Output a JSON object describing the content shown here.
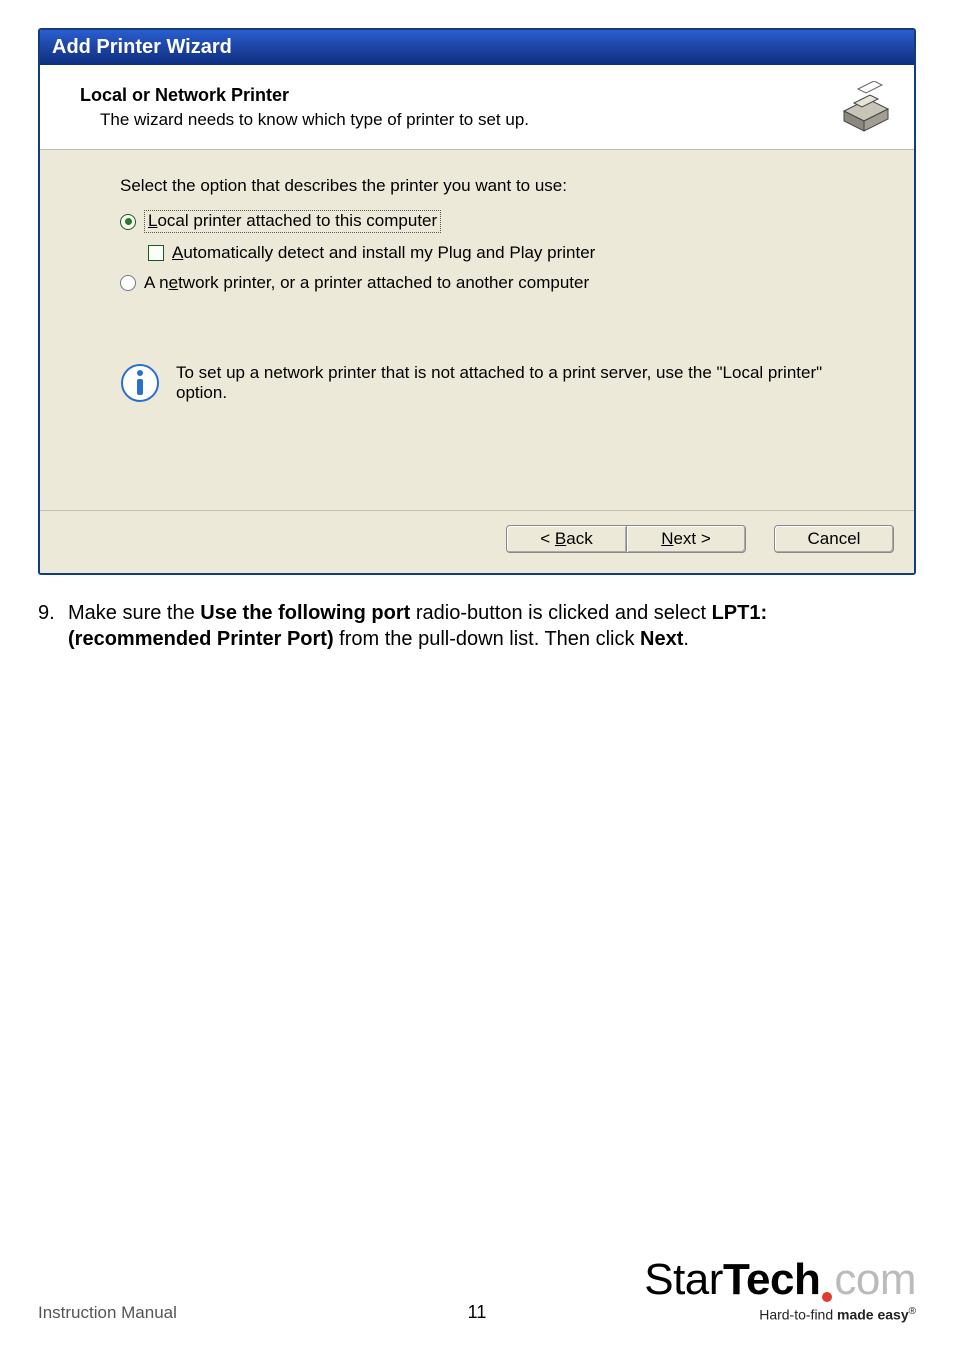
{
  "wizard": {
    "titlebar": "Add Printer Wizard",
    "heading": "Local or Network Printer",
    "subheading": "The wizard needs to know which type of printer to set up.",
    "select_prompt": "Select the option that describes the printer you want to use:",
    "option_local_pre": "L",
    "option_local_post": "ocal printer attached to this computer",
    "checkbox_auto_pre": "A",
    "checkbox_auto_post": "utomatically detect and install my Plug and Play printer",
    "option_network_pre": "A n",
    "option_network_mid": "e",
    "option_network_post": "twork printer, or a printer attached to another computer",
    "info_text": "To set up a network printer that is not attached to a print server, use the \"Local printer\" option.",
    "back_pre": "< ",
    "back_mid": "B",
    "back_post": "ack",
    "next_pre": "N",
    "next_post": "ext >",
    "cancel": "Cancel"
  },
  "step9": {
    "number": "9.",
    "t1": "Make sure the ",
    "b1": "Use the following port",
    "t2": " radio-button is clicked and select ",
    "b2": "LPT1: (recommended Printer Port)",
    "t3": " from the pull-down list. Then click ",
    "b3": "Next",
    "t4": "."
  },
  "footer": {
    "left": "Instruction Manual",
    "page_number": "11",
    "brand_star": "Star",
    "brand_tech": "Tech",
    "brand_com": "com",
    "tagline_pre": "Hard-to-find ",
    "tagline_bold": "made easy",
    "reg": "®"
  }
}
